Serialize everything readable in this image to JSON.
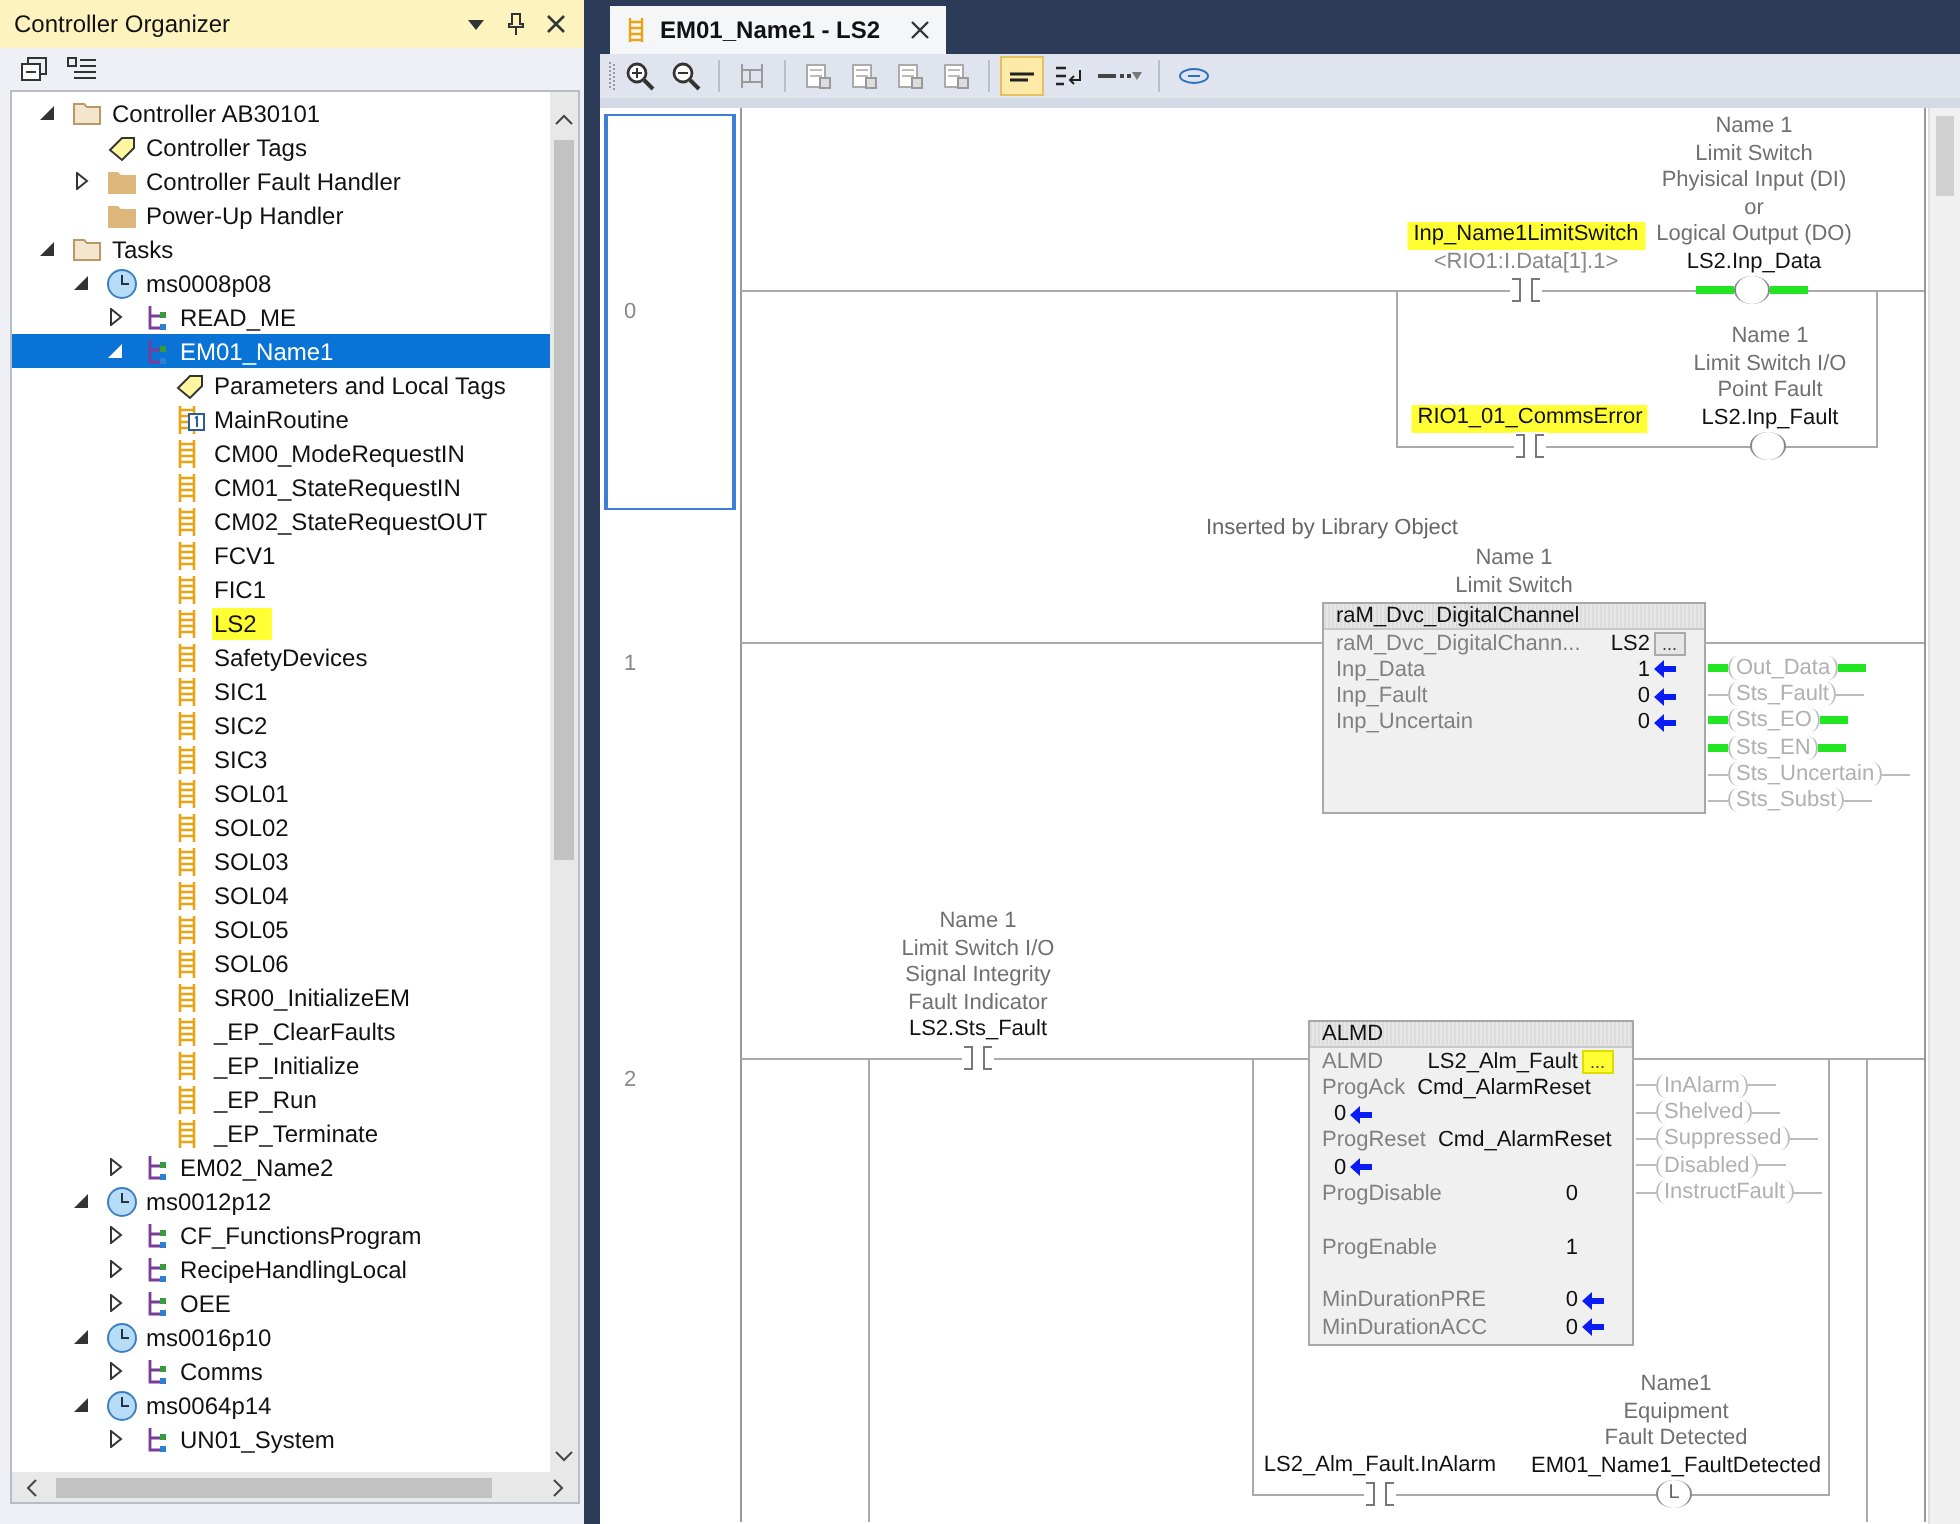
{
  "organizer": {
    "title": "Controller Organizer",
    "tree": [
      {
        "label": "Controller AB30101",
        "kind": "folder",
        "expanded": true,
        "selected": false,
        "children": [
          {
            "label": "Controller Tags",
            "kind": "tag",
            "selected": false
          },
          {
            "label": "Controller Fault Handler",
            "kind": "folder",
            "expanded": false,
            "selected": false
          },
          {
            "label": "Power-Up Handler",
            "kind": "folder",
            "selected": false
          }
        ]
      },
      {
        "label": "Tasks",
        "kind": "folder",
        "expanded": true,
        "selected": false,
        "children": [
          {
            "label": "ms0008p08",
            "kind": "task",
            "expanded": true,
            "selected": false,
            "children": [
              {
                "label": "READ_ME",
                "kind": "program",
                "expanded": false,
                "selected": false
              },
              {
                "label": "EM01_Name1",
                "kind": "program",
                "expanded": true,
                "selected": true,
                "children": [
                  {
                    "label": "Parameters and Local Tags",
                    "kind": "tag",
                    "selected": false,
                    "highlighted": false
                  },
                  {
                    "label": "MainRoutine",
                    "kind": "main-routine",
                    "selected": false,
                    "highlighted": false
                  },
                  {
                    "label": "CM00_ModeRequestIN",
                    "kind": "routine",
                    "selected": false,
                    "highlighted": false
                  },
                  {
                    "label": "CM01_StateRequestIN",
                    "kind": "routine",
                    "selected": false,
                    "highlighted": false
                  },
                  {
                    "label": "CM02_StateRequestOUT",
                    "kind": "routine",
                    "selected": false,
                    "highlighted": false
                  },
                  {
                    "label": "FCV1",
                    "kind": "routine",
                    "selected": false,
                    "highlighted": false
                  },
                  {
                    "label": "FIC1",
                    "kind": "routine",
                    "selected": false,
                    "highlighted": false
                  },
                  {
                    "label": "LS2",
                    "kind": "routine",
                    "selected": false,
                    "highlighted": true
                  },
                  {
                    "label": "SafetyDevices",
                    "kind": "routine",
                    "selected": false,
                    "highlighted": false
                  },
                  {
                    "label": "SIC1",
                    "kind": "routine",
                    "selected": false,
                    "highlighted": false
                  },
                  {
                    "label": "SIC2",
                    "kind": "routine",
                    "selected": false,
                    "highlighted": false
                  },
                  {
                    "label": "SIC3",
                    "kind": "routine",
                    "selected": false,
                    "highlighted": false
                  },
                  {
                    "label": "SOL01",
                    "kind": "routine",
                    "selected": false,
                    "highlighted": false
                  },
                  {
                    "label": "SOL02",
                    "kind": "routine",
                    "selected": false,
                    "highlighted": false
                  },
                  {
                    "label": "SOL03",
                    "kind": "routine",
                    "selected": false,
                    "highlighted": false
                  },
                  {
                    "label": "SOL04",
                    "kind": "routine",
                    "selected": false,
                    "highlighted": false
                  },
                  {
                    "label": "SOL05",
                    "kind": "routine",
                    "selected": false,
                    "highlighted": false
                  },
                  {
                    "label": "SOL06",
                    "kind": "routine",
                    "selected": false,
                    "highlighted": false
                  },
                  {
                    "label": "SR00_InitializeEM",
                    "kind": "routine",
                    "selected": false,
                    "highlighted": false
                  },
                  {
                    "label": "_EP_ClearFaults",
                    "kind": "routine",
                    "selected": false,
                    "highlighted": false
                  },
                  {
                    "label": "_EP_Initialize",
                    "kind": "routine",
                    "selected": false,
                    "highlighted": false
                  },
                  {
                    "label": "_EP_Run",
                    "kind": "routine",
                    "selected": false,
                    "highlighted": false
                  },
                  {
                    "label": "_EP_Terminate",
                    "kind": "routine",
                    "selected": false,
                    "highlighted": false
                  }
                ]
              },
              {
                "label": "EM02_Name2",
                "kind": "program",
                "expanded": false,
                "selected": false
              }
            ]
          },
          {
            "label": "ms0012p12",
            "kind": "task",
            "expanded": true,
            "selected": false,
            "children": [
              {
                "label": "CF_FunctionsProgram",
                "kind": "program",
                "expanded": false,
                "selected": false
              },
              {
                "label": "RecipeHandlingLocal",
                "kind": "program",
                "expanded": false,
                "selected": false
              },
              {
                "label": "OEE",
                "kind": "program",
                "expanded": false,
                "selected": false
              }
            ]
          },
          {
            "label": "ms0016p10",
            "kind": "task",
            "expanded": true,
            "selected": false,
            "children": [
              {
                "label": "Comms",
                "kind": "program",
                "expanded": false,
                "selected": false
              }
            ]
          },
          {
            "label": "ms0064p14",
            "kind": "task",
            "expanded": true,
            "selected": false,
            "children": [
              {
                "label": "UN01_System",
                "kind": "program",
                "expanded": false,
                "selected": false
              }
            ]
          }
        ]
      }
    ]
  },
  "editor": {
    "tabs": [
      {
        "title": "EM01_Name1 - LS2",
        "selected": true
      }
    ],
    "toolbar": [
      {
        "kind": "zoom-in",
        "pressed": false
      },
      {
        "kind": "zoom-out",
        "pressed": false
      },
      {
        "kind": "verify",
        "pressed": false
      },
      {
        "kind": "add-rung",
        "pressed": false
      },
      {
        "kind": "add-branch",
        "pressed": false
      },
      {
        "kind": "add-element",
        "pressed": false
      },
      {
        "kind": "edit-rung",
        "pressed": false
      },
      {
        "kind": "show-tags",
        "pressed": true
      },
      {
        "kind": "swap-text",
        "pressed": false
      },
      {
        "kind": "display-menu",
        "pressed": false
      },
      {
        "kind": "link",
        "pressed": false
      }
    ],
    "rungs": [
      {
        "number": "0",
        "kind": "parallel-coils",
        "selected": true,
        "branches": [
          {
            "contact": {
              "tag": "Inp_Name1LimitSwitch",
              "alias": "<RIO1:I.Data[1].1>",
              "highlighted": true
            },
            "coil": {
              "description": "Name 1\nLimit Switch\nPhyisical Input (DI)\nor\nLogical Output (DO)",
              "tag": "LS2.Inp_Data",
              "energized": true
            }
          },
          {
            "contact": {
              "tag": "RIO1_01_CommsError",
              "highlighted": true
            },
            "coil": {
              "description": "Name 1\nLimit Switch I/O\nPoint Fault",
              "tag": "LS2.Inp_Fault",
              "energized": false
            }
          }
        ]
      },
      {
        "number": "1",
        "kind": "aoi-block",
        "selected": false,
        "comment": "Inserted by Library Object",
        "block": {
          "description": "Name 1\nLimit Switch",
          "title": "raM_Dvc_DigitalChannel",
          "instance_type": "raM_Dvc_DigitalChann...",
          "instance": "LS2",
          "browse_button": "...",
          "browse_highlighted": false,
          "params": [
            {
              "name": "Inp_Data",
              "value": "1",
              "arrow": true
            },
            {
              "name": "Inp_Fault",
              "value": "0",
              "arrow": true
            },
            {
              "name": "Inp_Uncertain",
              "value": "0",
              "arrow": true
            }
          ],
          "outputs": [
            {
              "label": "Out_Data",
              "energized": true
            },
            {
              "label": "Sts_Fault",
              "energized": false
            },
            {
              "label": "Sts_EO",
              "energized": true
            },
            {
              "label": "Sts_EN",
              "energized": true
            },
            {
              "label": "Sts_Uncertain",
              "energized": false
            },
            {
              "label": "Sts_Subst",
              "energized": false
            }
          ]
        }
      },
      {
        "number": "2",
        "kind": "alarm-block",
        "selected": false,
        "contact": {
          "description": "Name 1\nLimit Switch I/O\nSignal Integrity\nFault Indicator",
          "tag": "LS2.Sts_Fault",
          "highlighted": false
        },
        "block": {
          "title": "ALMD",
          "instance_type": "ALMD",
          "instance": "LS2_Alm_Fault",
          "browse_button": "...",
          "browse_highlighted": true,
          "params": [
            {
              "name": "ProgAck",
              "value": "Cmd_AlarmReset",
              "arrow": false
            },
            {
              "value": "0",
              "arrow": true
            },
            {
              "name": "ProgReset",
              "value": "Cmd_AlarmReset",
              "arrow": false
            },
            {
              "value": "0",
              "arrow": true
            },
            {
              "name": "ProgDisable",
              "value": "0",
              "arrow": false
            },
            {
              "name": "ProgEnable",
              "value": "1",
              "arrow": false
            },
            {
              "name": "MinDurationPRE",
              "value": "0",
              "arrow": true
            },
            {
              "name": "MinDurationACC",
              "value": "0",
              "arrow": true
            }
          ],
          "outputs": [
            {
              "label": "InAlarm",
              "energized": false
            },
            {
              "label": "Shelved",
              "energized": false
            },
            {
              "label": "Suppressed",
              "energized": false
            },
            {
              "label": "Disabled",
              "energized": false
            },
            {
              "label": "InstructFault",
              "energized": false
            }
          ]
        },
        "branch": {
          "contact": {
            "tag": "LS2_Alm_Fault.InAlarm",
            "highlighted": false
          },
          "coil": {
            "description": "Name1\nEquipment\nFault Detected",
            "tag": "EM01_Name1_FaultDetected",
            "letter": "L",
            "energized": false
          }
        }
      }
    ]
  }
}
